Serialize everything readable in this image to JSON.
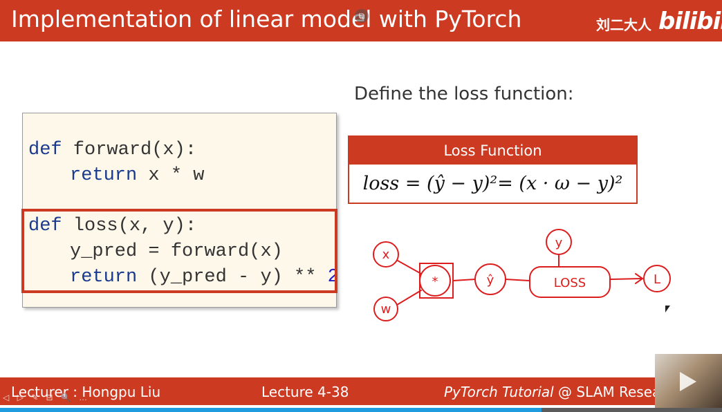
{
  "header": {
    "title": "Implementation of linear model with PyTorch",
    "author": "刘二大人",
    "logo": "bilibili",
    "overlay_icon": "picture-in-picture-icon"
  },
  "code": {
    "line1_kw": "def",
    "line1_rest": " forward(x):",
    "line2_kw": "return",
    "line2_rest": " x * w",
    "line3_kw": "def",
    "line3_rest": " loss(x, y):",
    "line4": "y_pred = forward(x)",
    "line5_kw": "return",
    "line5_rest": " (y_pred - y) ** ",
    "line5_num": "2"
  },
  "loss_section": {
    "heading": "Define the loss function:",
    "box_title": "Loss Function",
    "formula": "loss = (ŷ − y)²= (x · ω − y)²"
  },
  "diagram": {
    "nodes": [
      "x",
      "w",
      "*",
      "ŷ",
      "y",
      "LOSS",
      "L"
    ]
  },
  "footer": {
    "lecturer": "Lecturer : Hongpu Liu",
    "lecture": "Lecture 4-38",
    "tutorial": "PyTorch Tutorial",
    "org": " @ SLAM Resear"
  },
  "player": {
    "progress": 0.75,
    "accent": "#1f9be0",
    "brand": "#cc3a22"
  }
}
